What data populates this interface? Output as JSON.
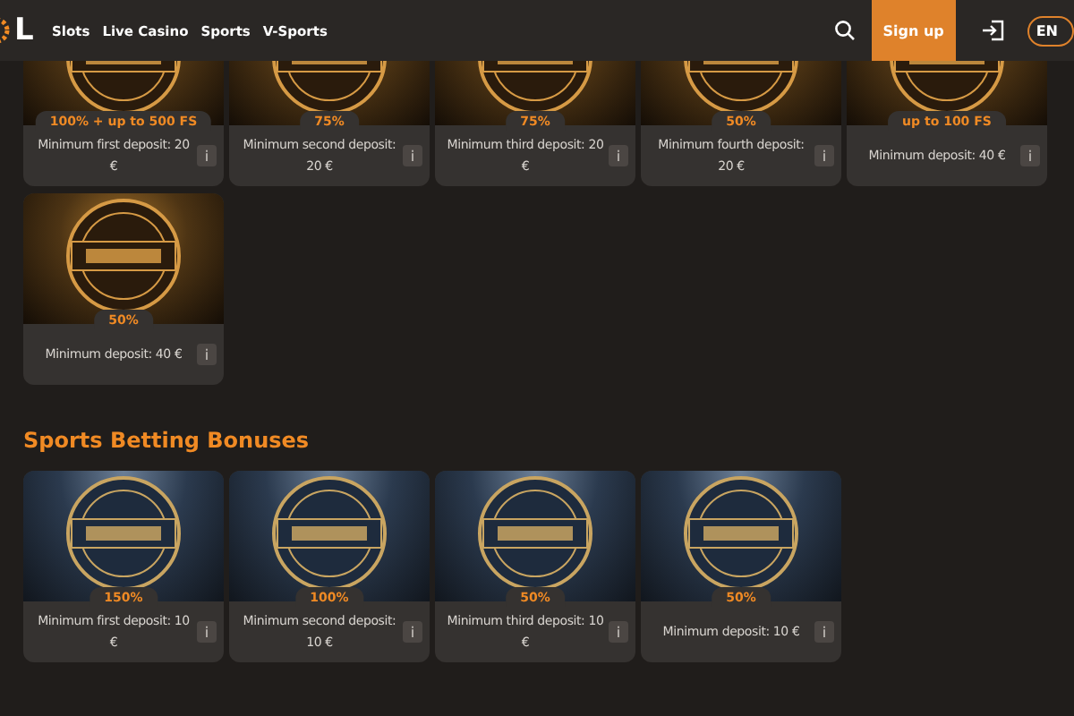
{
  "header": {
    "logo": "L",
    "nav": [
      "Slots",
      "Live Casino",
      "Sports",
      "V-Sports"
    ],
    "signup": "Sign up",
    "language": "EN"
  },
  "casino_bonuses": [
    {
      "kind": "gold",
      "badge": "100% + up to 500 FS",
      "description": "Minimum first deposit: 20 €",
      "info": "i"
    },
    {
      "kind": "gold",
      "badge": "75%",
      "description": "Minimum second deposit: 20 €",
      "info": "i"
    },
    {
      "kind": "gold",
      "badge": "75%",
      "description": "Minimum third deposit: 20 €",
      "info": "i"
    },
    {
      "kind": "gold",
      "badge": "50%",
      "description": "Minimum fourth deposit: 20 €",
      "info": "i"
    },
    {
      "kind": "gold",
      "badge": "up to 100 FS",
      "description": "Minimum deposit: 40 €",
      "info": "i"
    },
    {
      "kind": "gold",
      "badge": "50%",
      "description": "Minimum deposit: 40 €",
      "info": "i"
    }
  ],
  "sports_section": {
    "title": "Sports Betting Bonuses",
    "bonuses": [
      {
        "kind": "blue",
        "badge": "150%",
        "description": "Minimum first deposit: 10 €",
        "info": "i"
      },
      {
        "kind": "blue",
        "badge": "100%",
        "description": "Minimum second deposit: 10 €",
        "info": "i"
      },
      {
        "kind": "blue",
        "badge": "50%",
        "description": "Minimum third deposit: 10 €",
        "info": "i"
      },
      {
        "kind": "blue",
        "badge": "50%",
        "description": "Minimum deposit: 10 €",
        "info": "i"
      }
    ]
  }
}
